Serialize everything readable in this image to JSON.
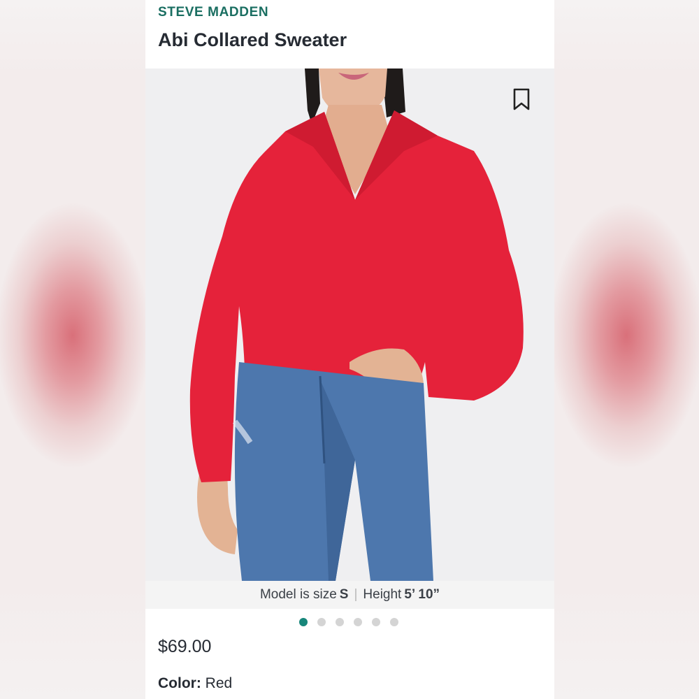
{
  "product": {
    "brand": "STEVE MADDEN",
    "name": "Abi Collared Sweater",
    "image_alt": "Model wearing red collared sweater and blue jeans",
    "bookmark_icon": "bookmark-icon",
    "model_info": {
      "size_prefix": "Model is size",
      "size_value": "S",
      "separator": "|",
      "height_prefix": "Height",
      "height_value": "5’ 10”"
    },
    "carousel": {
      "total": 6,
      "active_index": 0
    },
    "price": "$69.00",
    "color": {
      "label": "Color:",
      "value": "Red"
    }
  },
  "colors": {
    "brand": "#1a6e61",
    "active_dot": "#17867a",
    "sweater": "#e5223a",
    "jeans": "#4d77ad"
  }
}
